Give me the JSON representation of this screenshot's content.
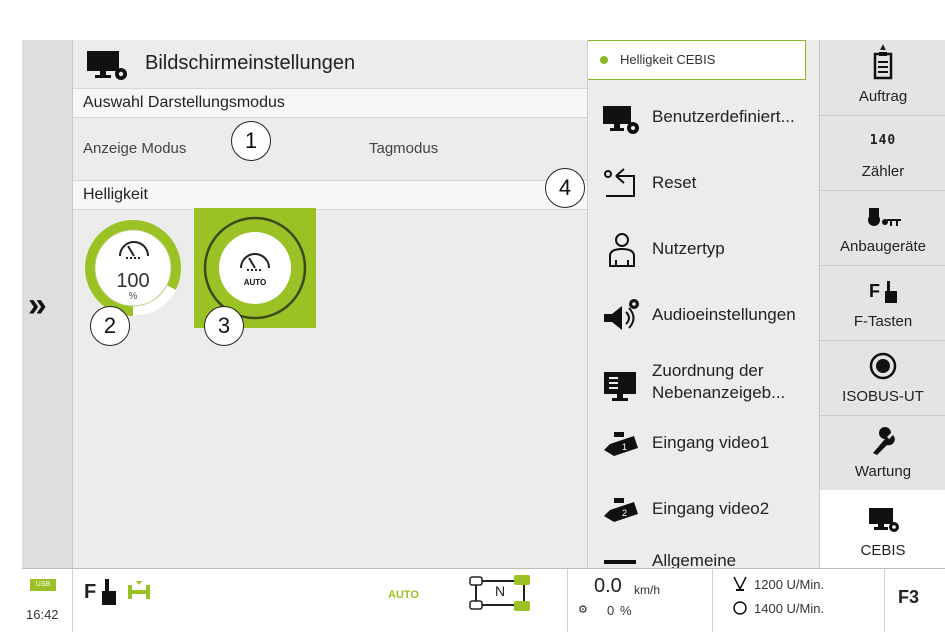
{
  "colors": {
    "accent": "#8bb82a",
    "dark": "#222222",
    "panel": "#ececec"
  },
  "main": {
    "title": "Bildschirmeinstellungen",
    "section1": "Auswahl Darstellungsmodus",
    "mode_label": "Anzeige Modus",
    "mode_value": "Tagmodus",
    "section2": "Helligkeit",
    "brightness_value": "100",
    "brightness_unit": "%",
    "auto_label": "AUTO",
    "brightness_level": 1.0
  },
  "callouts": [
    "1",
    "2",
    "3",
    "4"
  ],
  "menu": {
    "header": "Helligkeit CEBIS",
    "items": [
      {
        "label": "Benutzerdefiniert...",
        "icon": "monitor-gear-icon"
      },
      {
        "label": "Reset",
        "icon": "reset-icon"
      },
      {
        "label": "Nutzertyp",
        "icon": "user-icon"
      },
      {
        "label": "Audioeinstellungen",
        "icon": "speaker-gear-icon"
      },
      {
        "label": "Zuordnung der Nebenanzeigeb...",
        "icon": "monitor-assign-icon"
      },
      {
        "label": "Eingang video1",
        "icon": "camera-1-icon"
      },
      {
        "label": "Eingang video2",
        "icon": "camera-2-icon"
      },
      {
        "label": "Allgemeine",
        "icon": "general-icon"
      }
    ]
  },
  "tabs": [
    {
      "label": "Auftrag",
      "icon": "clipboard-icon"
    },
    {
      "label": "Zähler",
      "icon": "counter-icon"
    },
    {
      "label": "Anbaugeräte",
      "icon": "tractor-implement-icon"
    },
    {
      "label": "F-Tasten",
      "icon": "f-key-hand-icon"
    },
    {
      "label": "ISOBUS-UT",
      "icon": "isobus-icon"
    },
    {
      "label": "Wartung",
      "icon": "wrench-icon"
    },
    {
      "label": "CEBIS",
      "icon": "monitor-gear-icon"
    }
  ],
  "counter_digits": "140",
  "status": {
    "usb": "USB",
    "time": "16:42",
    "f_label": "F",
    "auto": "AUTO",
    "gear": "N",
    "speed": "0.0",
    "speed_unit": "km/h",
    "slip": "0",
    "slip_unit": "%",
    "rpm1": "1200 U/Min.",
    "rpm2": "1400 U/Min.",
    "fkey": "F3"
  }
}
